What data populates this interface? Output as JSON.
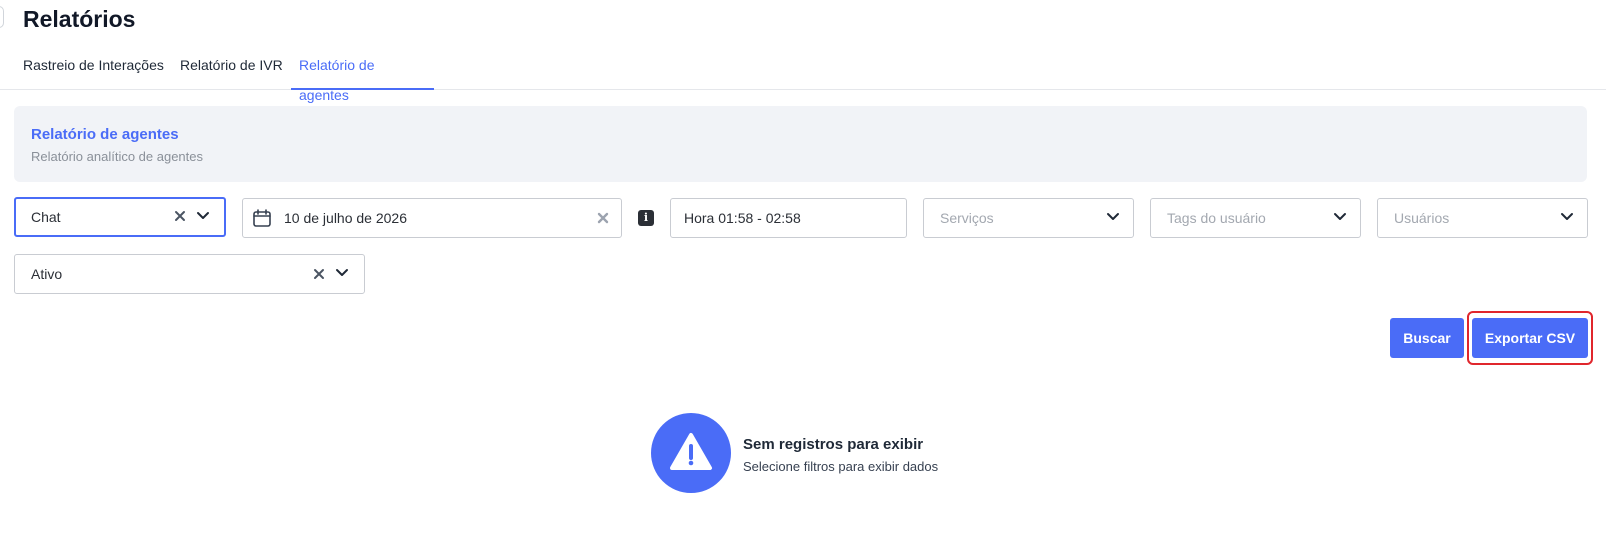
{
  "header": {
    "title": "Relatórios"
  },
  "tabs": [
    {
      "label": "Rastreio de Interações",
      "active": false
    },
    {
      "label": "Relatório de IVR",
      "active": false
    },
    {
      "label": "Relatório de agentes",
      "active": true
    }
  ],
  "info_card": {
    "title": "Relatório de agentes",
    "subtitle": "Relatório analítico de agentes"
  },
  "filters": {
    "channel": {
      "value": "Chat"
    },
    "date": {
      "value": "10 de julho de 2026"
    },
    "time": {
      "value": "Hora 01:58 - 02:58"
    },
    "services": {
      "placeholder": "Serviços"
    },
    "user_tags": {
      "placeholder": "Tags do usuário"
    },
    "users": {
      "placeholder": "Usuários"
    },
    "status": {
      "value": "Ativo"
    }
  },
  "actions": {
    "search_label": "Buscar",
    "export_label": "Exportar CSV"
  },
  "empty_state": {
    "title": "Sem registros para exibir",
    "subtitle": "Selecione filtros para exibir dados"
  },
  "colors": {
    "accent": "#4a6cf7",
    "highlight": "#e0262c",
    "card_bg": "#f1f3f7"
  },
  "icons": [
    "calendar-icon",
    "info-icon",
    "warning-icon",
    "chevron-down-icon",
    "close-icon"
  ]
}
